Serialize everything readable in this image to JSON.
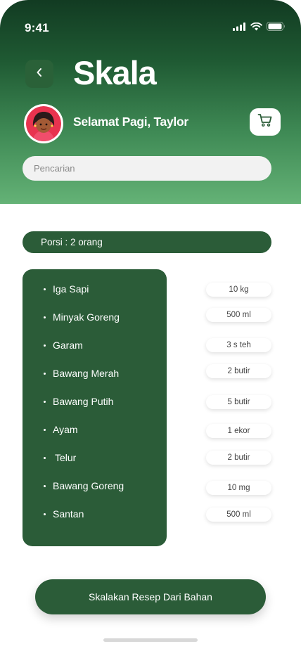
{
  "status": {
    "time": "9:41"
  },
  "header": {
    "title": "Skala",
    "greeting": "Selamat Pagi, Taylor",
    "search_placeholder": "Pencarian"
  },
  "porsi": {
    "label": "Porsi : 2 orang"
  },
  "ingredients": [
    {
      "name": "Iga Sapi",
      "qty": "10 kg"
    },
    {
      "name": "Minyak Goreng",
      "qty": "500 ml"
    },
    {
      "name": "Garam",
      "qty": "3 s teh"
    },
    {
      "name": "Bawang Merah",
      "qty": "2 butir"
    },
    {
      "name": "Bawang Putih",
      "qty": "5 butir"
    },
    {
      "name": "Ayam",
      "qty": "1 ekor"
    },
    {
      "name": "Telur",
      "qty": "2 butir"
    },
    {
      "name": "Bawang Goreng",
      "qty": "10 mg"
    },
    {
      "name": "Santan",
      "qty": "500 ml"
    }
  ],
  "actions": {
    "scale_button": "Skalakan Resep Dari Bahan"
  },
  "colors": {
    "primary": "#2b5c38",
    "header_top": "#123b22",
    "header_bottom": "#64b276"
  }
}
